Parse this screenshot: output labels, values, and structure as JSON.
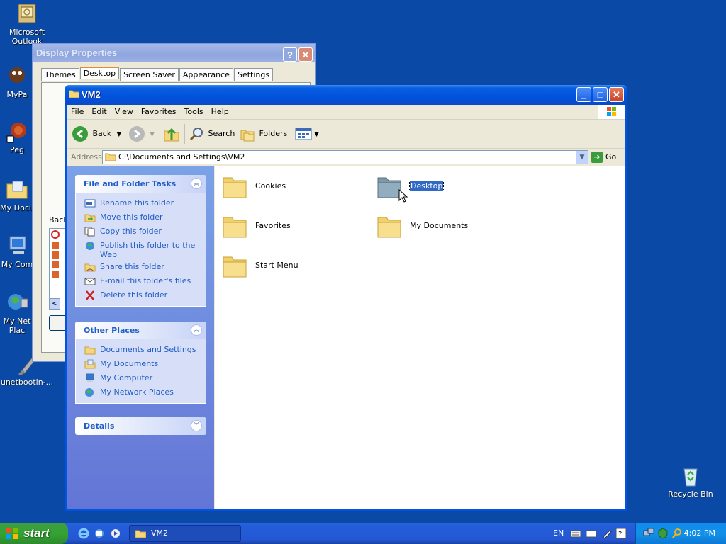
{
  "desktop": {
    "icons": [
      {
        "label": "Microsoft Outlook",
        "icon": "outlook-icon"
      },
      {
        "label": "MyPa",
        "icon": "mypal-icon"
      },
      {
        "label": "Peg",
        "icon": "pegasus-icon"
      },
      {
        "label": "My Docu",
        "icon": "my-documents-icon"
      },
      {
        "label": "My Com",
        "icon": "my-computer-icon"
      },
      {
        "label": "My Net Plac",
        "icon": "my-network-places-icon"
      },
      {
        "label": "unetbootin-...",
        "icon": "unetbootin-icon"
      },
      {
        "label": "Recycle Bin",
        "icon": "recycle-bin-icon"
      }
    ]
  },
  "display_properties": {
    "title": "Display Properties",
    "tabs": [
      "Themes",
      "Desktop",
      "Screen Saver",
      "Appearance",
      "Settings"
    ],
    "active_tab": "Desktop",
    "background_label": "Back"
  },
  "explorer": {
    "title": "VM2",
    "menu": [
      "File",
      "Edit",
      "View",
      "Favorites",
      "Tools",
      "Help"
    ],
    "toolbar": {
      "back": "Back",
      "search": "Search",
      "folders": "Folders"
    },
    "address": {
      "label": "Address",
      "value": "C:\\Documents and Settings\\VM2",
      "go": "Go"
    },
    "tasks_panel": {
      "title": "File and Folder Tasks",
      "items": [
        "Rename this folder",
        "Move this folder",
        "Copy this folder",
        "Publish this folder to the Web",
        "Share this folder",
        "E-mail this folder's files",
        "Delete this folder"
      ]
    },
    "other_places": {
      "title": "Other Places",
      "items": [
        "Documents and Settings",
        "My Documents",
        "My Computer",
        "My Network Places"
      ]
    },
    "details": {
      "title": "Details"
    },
    "folders": [
      "Cookies",
      "Desktop",
      "Favorites",
      "My Documents",
      "Start Menu"
    ],
    "selected_folder": "Desktop"
  },
  "taskbar": {
    "start": "start",
    "task": "VM2",
    "language": "EN",
    "clock": "4:02 PM"
  },
  "colors": {
    "desktop_bg": "#0a4aa6",
    "title_bar": "#0054e3",
    "link": "#215dc6",
    "selection": "#316ac5"
  }
}
